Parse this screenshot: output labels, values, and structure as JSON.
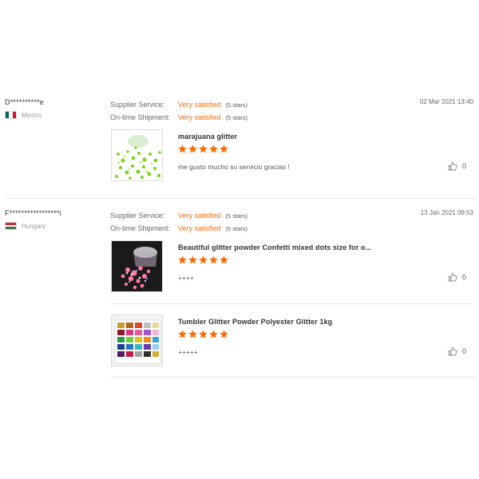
{
  "reviews": [
    {
      "buyer": "D**********e",
      "country": "Mexico",
      "flag_colors": [
        "#006847",
        "#ffffff",
        "#ce1126"
      ],
      "date": "02 Mar 2021 13:40",
      "supplier_service": {
        "label": "Supplier Service:",
        "value": "Very satisfied",
        "stars": "(5 stars)"
      },
      "ontime_shipment": {
        "label": "On-time Shipment:",
        "value": "Very satisfied",
        "stars": "(5 stars)"
      },
      "items": [
        {
          "title": "marajuana glitter",
          "rating": 5,
          "comment": "me gusto mucho su servicio gracias !",
          "likes": "0",
          "thumb": "green-glitter-image"
        }
      ]
    },
    {
      "buyer": "F*****************i",
      "country": "Hungary",
      "flag_colors": [
        "#ce2939",
        "#ffffff",
        "#477050"
      ],
      "date": "13 Jan 2021 09:53",
      "supplier_service": {
        "label": "Supplier Service:",
        "value": "Very satisfied",
        "stars": "(5 stars)"
      },
      "ontime_shipment": {
        "label": "On-time Shipment:",
        "value": "Very satisfied",
        "stars": "(5 stars)"
      },
      "items": [
        {
          "title": "Beautiful glitter powder Confetti mixed dots size for o...",
          "rating": 5,
          "comment": "++++",
          "likes": "0",
          "thumb": "pink-glitter-jar-image"
        },
        {
          "title": "Tumbler Glitter Powder Polyester Glitter 1kg",
          "rating": 5,
          "comment": "+++++",
          "likes": "0",
          "thumb": "glitter-color-chart-image"
        }
      ]
    }
  ],
  "colors": {
    "accent": "#ff6a00",
    "divider": "#e6e6e6"
  },
  "icons": {
    "star": "star-icon",
    "like": "thumbs-up-icon"
  }
}
